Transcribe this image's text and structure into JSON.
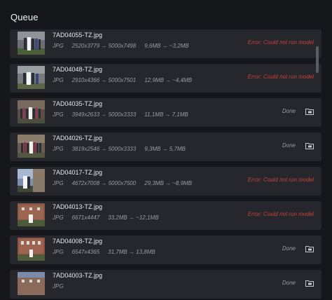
{
  "header": {
    "title": "Queue"
  },
  "queue": [
    {
      "filename": "7AD04055-TZ.jpg",
      "format": "JPG",
      "resolution": "2520x3779 → 5000x7498",
      "size": "9,6MB → ~3,2MB",
      "status": "Error: Could not run model",
      "state": "error"
    },
    {
      "filename": "7AD04048-TZ.jpg",
      "format": "JPG",
      "resolution": "2910x4366 → 5000x7501",
      "size": "12,9MB → ~4,4MB",
      "status": "Error: Could not run model",
      "state": "error"
    },
    {
      "filename": "7AD04035-TZ.jpg",
      "format": "JPG",
      "resolution": "3949x2633 → 5000x3333",
      "size": "11,1MB → 7,1MB",
      "status": "Done",
      "state": "done"
    },
    {
      "filename": "7AD04026-TZ.jpg",
      "format": "JPG",
      "resolution": "3819x2546 → 5000x3333",
      "size": "9,3MB → 5,7MB",
      "status": "Done",
      "state": "done"
    },
    {
      "filename": "7AD04017-TZ.jpg",
      "format": "JPG",
      "resolution": "4672x7008 → 5000x7500",
      "size": "29,3MB → ~8,9MB",
      "status": "Error: Could not run model",
      "state": "error"
    },
    {
      "filename": "7AD04013-TZ.jpg",
      "format": "JPG",
      "resolution": "6671x4447",
      "size": "33,2MB → ~12,1MB",
      "status": "Error: Could not run model",
      "state": "error"
    },
    {
      "filename": "7AD04008-TZ.jpg",
      "format": "JPG",
      "resolution": "6547x4365",
      "size": "31,7MB → 13,8MB",
      "status": "Done",
      "state": "done"
    },
    {
      "filename": "7AD04003-TZ.jpg",
      "format": "JPG",
      "resolution": "",
      "size": "",
      "status": "Done",
      "state": "done"
    }
  ],
  "colors": {
    "background": "#16171b",
    "row": "#25272c",
    "error": "#c9413b",
    "muted": "#9a9ca2"
  },
  "icons": {
    "done_action": "folder-icon"
  }
}
